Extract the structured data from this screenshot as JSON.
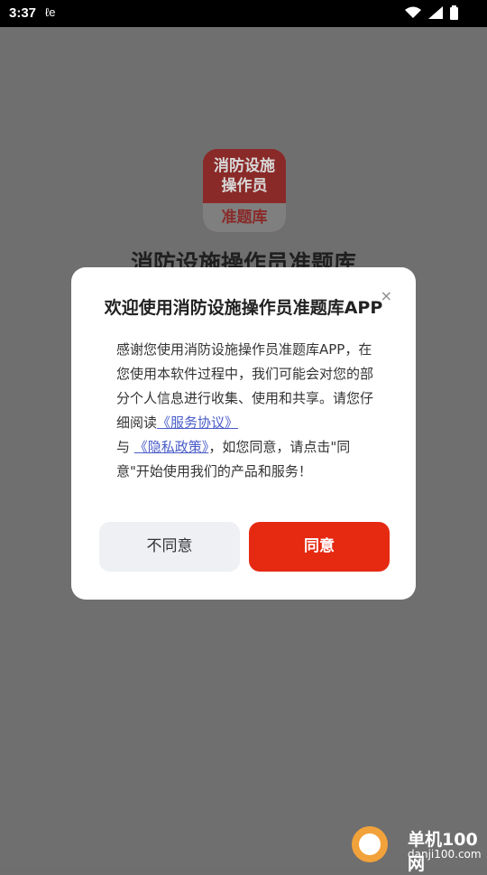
{
  "status_bar": {
    "time": "3:37",
    "carrier_icon": "le-icon",
    "wifi_icon": "wifi-icon",
    "signal_icon": "signal-icon",
    "battery_icon": "battery-icon"
  },
  "app": {
    "icon_top_text": "消防设施\n操作员",
    "icon_bottom_text": "准题库",
    "name": "消防设施操作员准题库"
  },
  "dialog": {
    "title": "欢迎使用消防设施操作员准题库APP",
    "close_icon": "close-icon",
    "body_text_1": "感谢您使用消防设施操作员准题库APP，在您使用本软件过程中，我们可能会对您的部分个人信息进行收集、使用和共享。请您仔细阅读",
    "service_link": "《服务协议》",
    "body_text_2": "与",
    "privacy_link": "《隐私政策》",
    "body_text_3": "，如您同意，请点击\"同意\"开始使用我们的产品和服务！",
    "disagree_label": "不同意",
    "agree_label": "同意"
  },
  "watermark": {
    "title": "单机100网",
    "url": "danji100.com"
  },
  "colors": {
    "accent": "#e62a12",
    "link": "#4a5cc8"
  }
}
